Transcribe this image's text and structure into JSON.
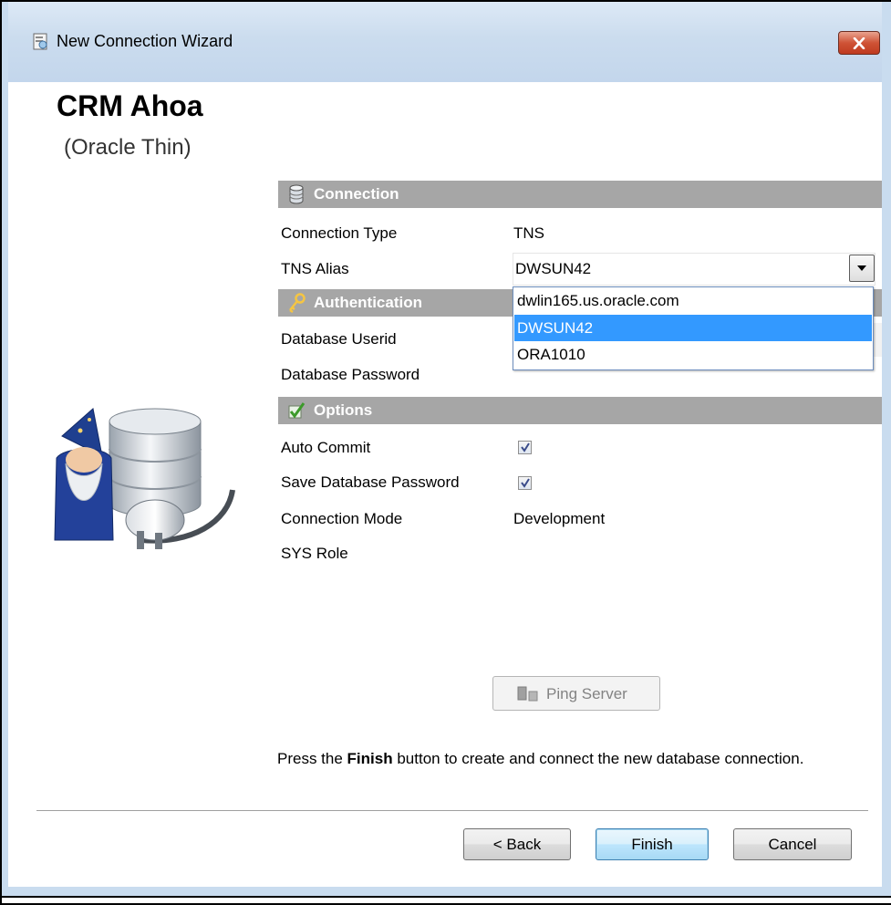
{
  "window": {
    "title": "New Connection Wizard",
    "icon": "wizard-app-icon",
    "close_icon": "close-icon"
  },
  "header": {
    "connection_name": "CRM Ahoa",
    "connection_type": "(Oracle Thin)"
  },
  "sections": {
    "connection": {
      "label": "Connection",
      "icon": "database-icon"
    },
    "authentication": {
      "label": "Authentication",
      "icon": "key-icon"
    },
    "options": {
      "label": "Options",
      "icon": "checkmark-icon"
    }
  },
  "fields": {
    "connection_type": {
      "label": "Connection Type",
      "value": "TNS"
    },
    "tns_alias": {
      "label": "TNS Alias",
      "value": "DWSUN42"
    },
    "database_userid": {
      "label": "Database Userid",
      "value": ""
    },
    "database_password": {
      "label": "Database Password",
      "value": ""
    },
    "auto_commit": {
      "label": "Auto Commit",
      "checked": true
    },
    "save_password": {
      "label": "Save Database Password",
      "checked": true
    },
    "connection_mode": {
      "label": "Connection Mode",
      "value": "Development"
    },
    "sys_role": {
      "label": "SYS Role",
      "value": ""
    }
  },
  "tns_dropdown": {
    "options": [
      "dwlin165.us.oracle.com",
      "DWSUN42",
      "ORA1010"
    ],
    "selected_index": 1,
    "highlight_color": "#3399ff"
  },
  "ping_button": {
    "label": "Ping Server",
    "icon": "server-icon",
    "enabled": false
  },
  "instructions": {
    "prefix": "Press the ",
    "bold": "Finish",
    "suffix": " button to create and connect the new database connection."
  },
  "buttons": {
    "back": "< Back",
    "finish": "Finish",
    "cancel": "Cancel"
  },
  "colors": {
    "section_header": "#a6a6a6",
    "title_bar": "#c3d6ec",
    "close_button": "#c9462a"
  }
}
